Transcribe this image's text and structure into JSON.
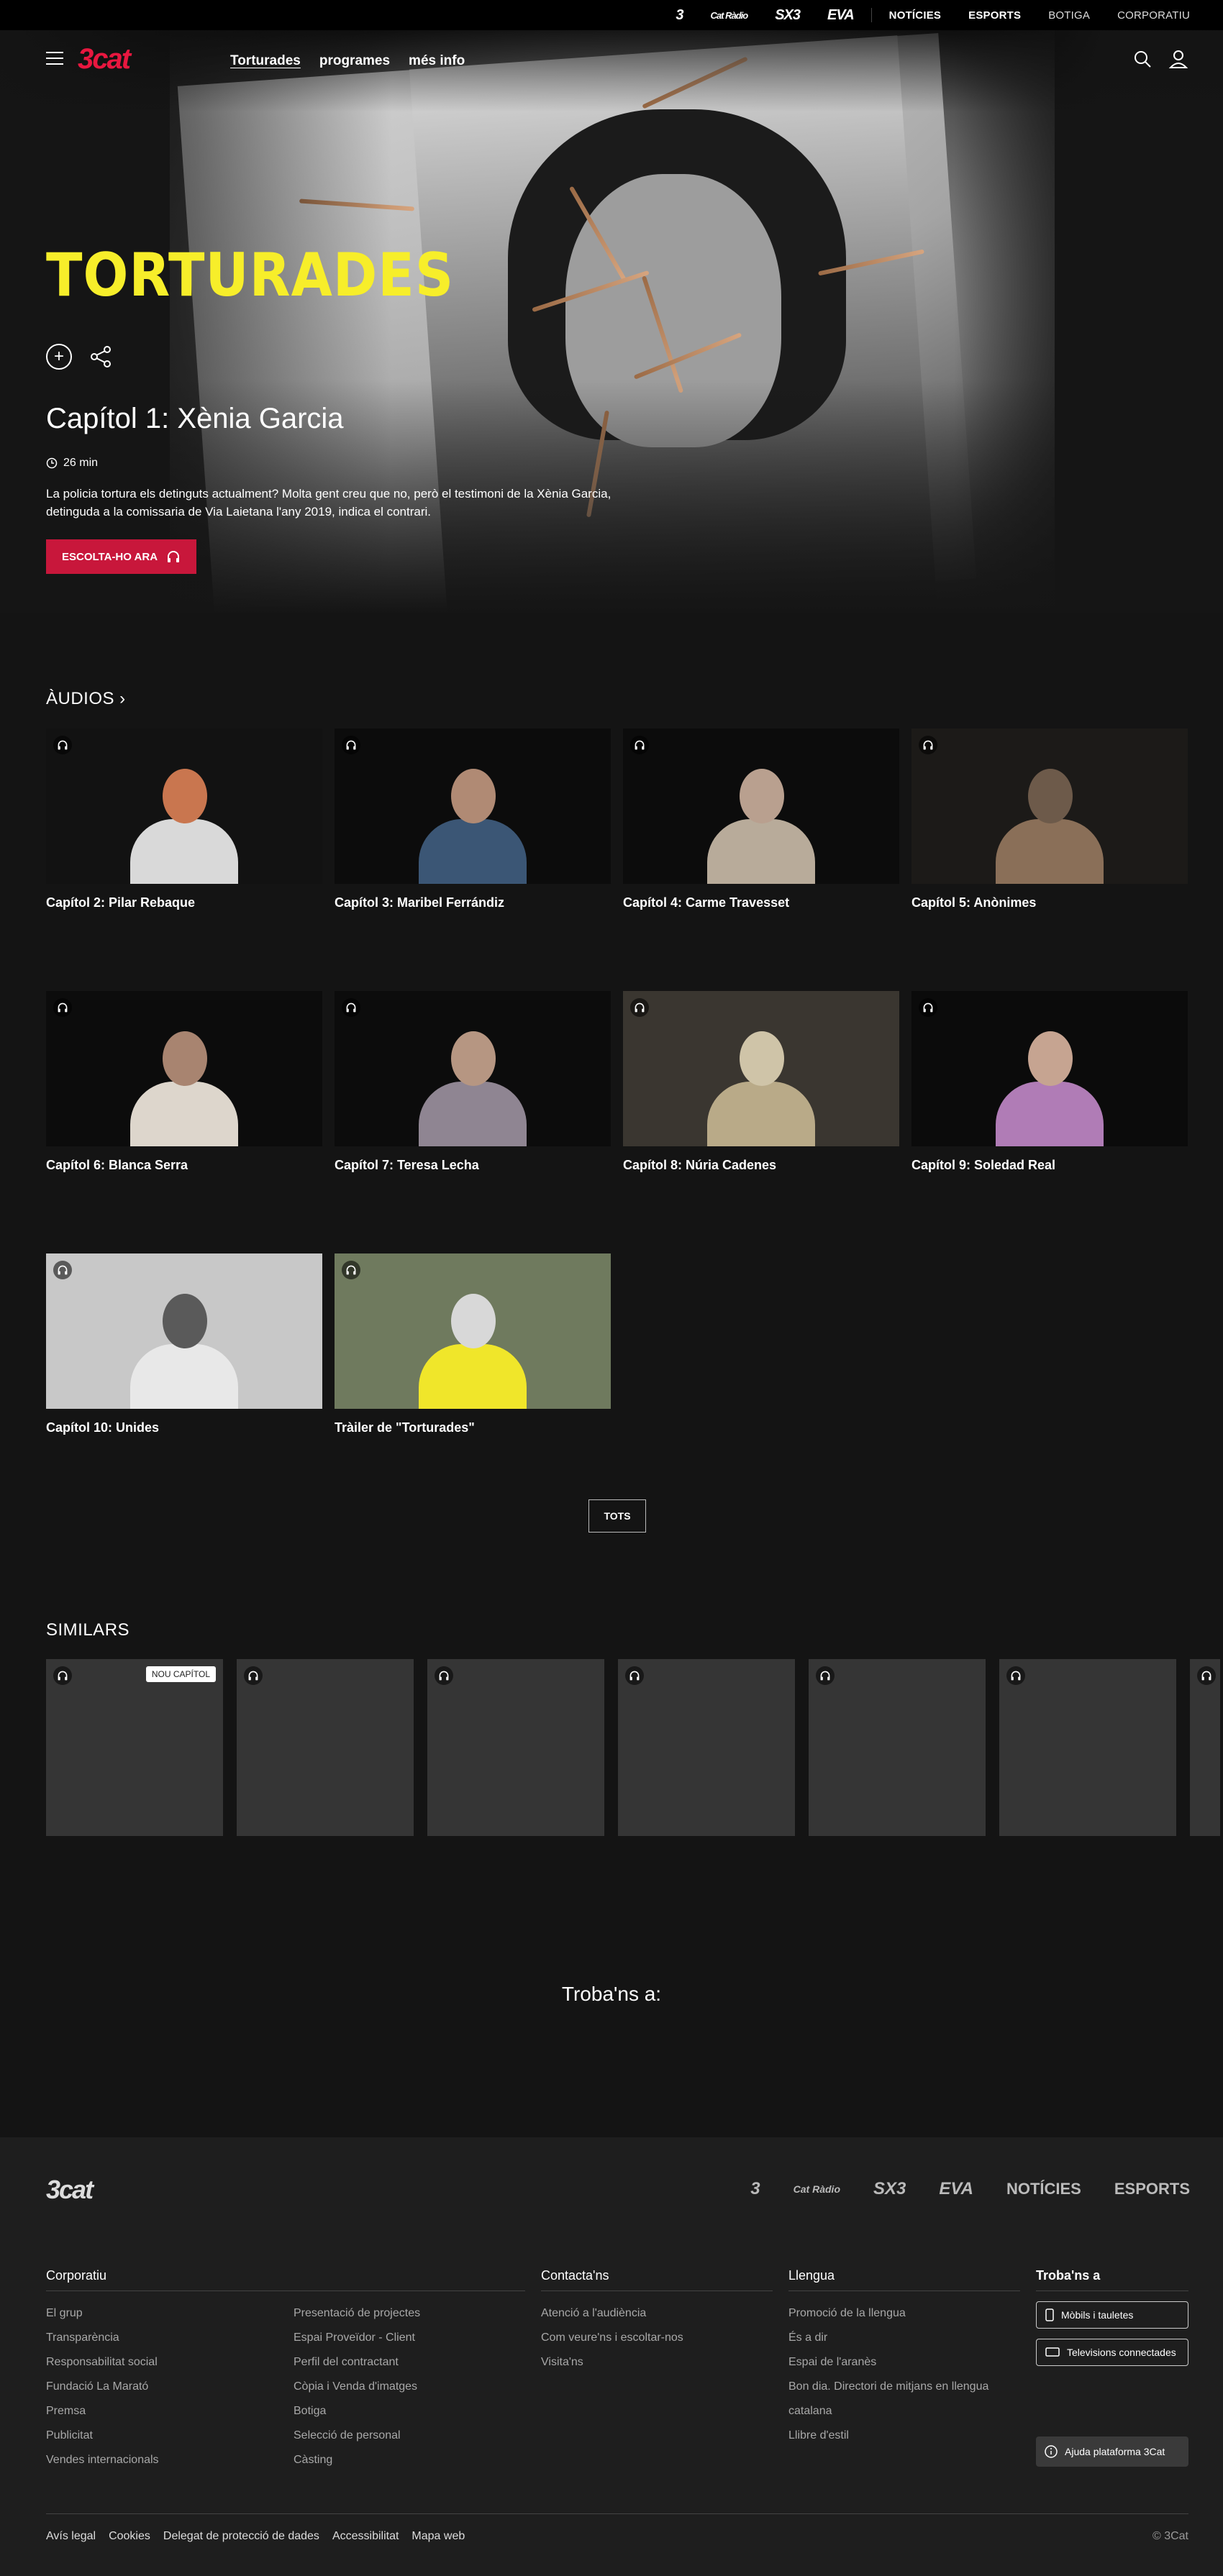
{
  "topbar": {
    "brands": [
      "3",
      "Cat Ràdio",
      "SX3",
      "EVA"
    ],
    "links": [
      "NOTÍCIES",
      "ESPORTS",
      "BOTIGA",
      "CORPORATIU"
    ]
  },
  "nav": {
    "logo": "3cat",
    "menu": [
      "Torturades",
      "programes",
      "més info"
    ]
  },
  "hero": {
    "show_title": "TORTURADES",
    "episode_title": "Capítol 1: Xènia Garcia",
    "duration": "26 min",
    "description": "La policia tortura els detinguts actualment? Molta gent creu que no, però el testimoni de la Xènia Garcia, detinguda a la comissaria de Via Laietana l'any 2019, indica el contrari.",
    "listen_label": "ESCOLTA-HO ARA"
  },
  "audios": {
    "title": "ÀUDIOS",
    "items": [
      {
        "label": "Capítol 2: Pilar Rebaque"
      },
      {
        "label": "Capítol 3: Maribel Ferrándiz"
      },
      {
        "label": "Capítol 4: Carme Travesset"
      },
      {
        "label": "Capítol 5: Anònimes"
      },
      {
        "label": "Capítol 6: Blanca Serra"
      },
      {
        "label": "Capítol 7: Teresa Lecha"
      },
      {
        "label": "Capítol 8: Núria Cadenes"
      },
      {
        "label": "Capítol 9: Soledad Real"
      },
      {
        "label": "Capítol 10: Unides"
      },
      {
        "label": "Tràiler de \"Torturades\""
      }
    ],
    "all_label": "TOTS"
  },
  "similars": {
    "title": "SIMILARS",
    "badge": "NOU CAPÍTOL"
  },
  "find_us": "Troba'ns a:",
  "footer": {
    "logo": "3cat",
    "brands": [
      "3",
      "Cat Ràdio",
      "SX3",
      "EVA",
      "NOTÍCIES",
      "ESPORTS"
    ],
    "corporatiu": {
      "title": "Corporatiu",
      "col1": [
        "El grup",
        "Transparència",
        "Responsabilitat social",
        "Fundació La Marató",
        "Premsa",
        "Publicitat",
        "Vendes internacionals"
      ],
      "col2": [
        "Presentació de projectes",
        "Espai Proveïdor - Client",
        "Perfil del contractant",
        "Còpia i Venda d'imatges",
        "Botiga",
        "Selecció de personal",
        "Càsting"
      ]
    },
    "contact": {
      "title": "Contacta'ns",
      "items": [
        "Atenció a l'audiència",
        "Com veure'ns i escoltar-nos",
        "Visita'ns"
      ]
    },
    "language": {
      "title": "Llengua",
      "items": [
        "Promoció de la llengua",
        "És a dir",
        "Espai de l'aranès",
        "Bon dia. Directori de mitjans en llengua catalana",
        "Llibre d'estil"
      ]
    },
    "find": {
      "title": "Troba'ns a",
      "mobile": "Mòbils i tauletes",
      "tv": "Televisions connectades"
    },
    "help": "Ajuda plataforma 3Cat",
    "bottom_links": [
      "Avís legal",
      "Cookies",
      "Delegat de protecció de dades",
      "Accessibilitat",
      "Mapa web"
    ],
    "copyright": "© 3Cat"
  },
  "colors": {
    "accent": "#c8173b",
    "title_yellow": "#f7ee2a",
    "background": "#141414"
  }
}
